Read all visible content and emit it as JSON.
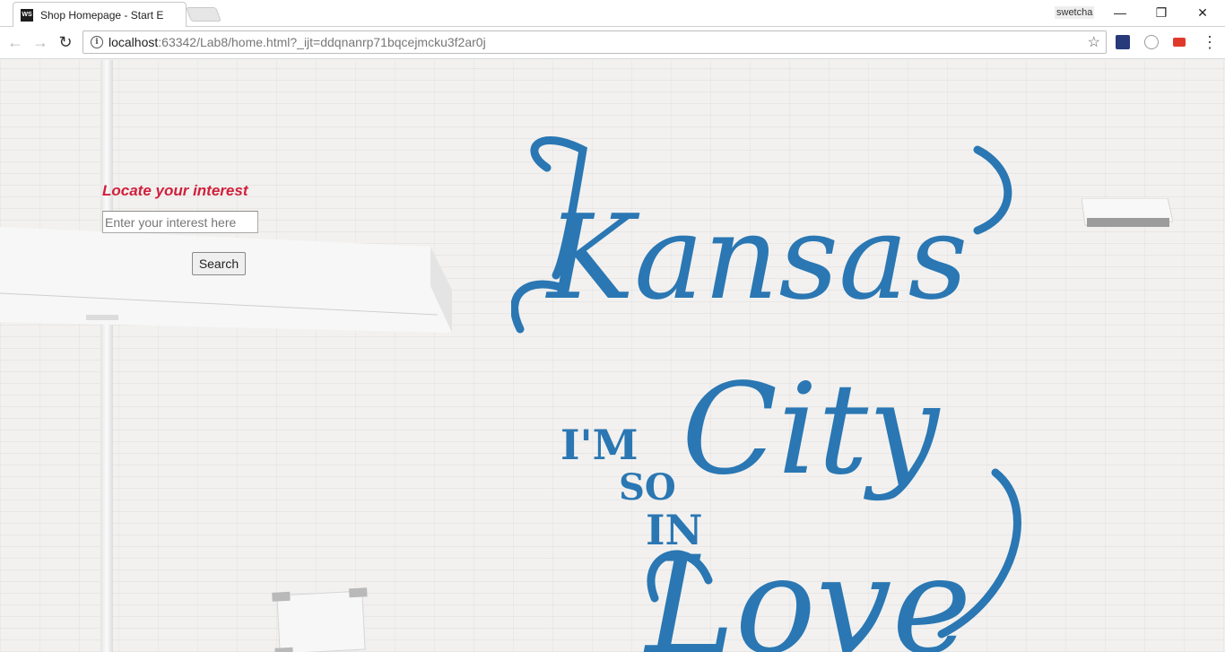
{
  "browser": {
    "tab_title": "Shop Homepage - Start E",
    "tab_favicon": "WS",
    "profile_name": "swetcha",
    "url_host": "localhost",
    "url_rest": ":63342/Lab8/home.html?_ijt=ddqnanrp71bqcejmcku3f2ar0j"
  },
  "icons": {
    "back": "←",
    "forward": "→",
    "reload": "↻",
    "info": "i",
    "star": "☆",
    "menu": "⋮",
    "minimize": "—",
    "maximize": "❐",
    "close": "✕"
  },
  "page": {
    "search_heading": "Locate your interest",
    "search_placeholder": "Enter your interest here",
    "search_value": "",
    "search_button": "Search",
    "heading_color": "#d11f3c"
  },
  "mural": {
    "word1": "Kansas",
    "word2": "I'M",
    "word3": "SO",
    "word4": "IN",
    "word5": "City",
    "word6": "Love",
    "color": "#2a77b3"
  }
}
